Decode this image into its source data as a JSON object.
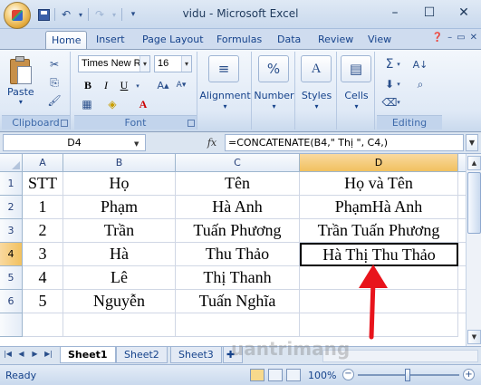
{
  "window": {
    "title": "vidu - Microsoft Excel",
    "minimize": "–",
    "maximize": "☐",
    "close": "✕"
  },
  "quick_access": {
    "undo": "↶",
    "redo": "↷",
    "more": "▾"
  },
  "tabs": [
    "Home",
    "Insert",
    "Page Layout",
    "Formulas",
    "Data",
    "Review",
    "View"
  ],
  "active_tab": "Home",
  "ribbon": {
    "clipboard": {
      "label": "Clipboard",
      "paste": "Paste"
    },
    "font": {
      "label": "Font",
      "font_name": "Times New Ro",
      "font_size": "16",
      "bold": "B",
      "italic": "I",
      "underline": "U"
    },
    "alignment": {
      "label": "Alignment"
    },
    "number": {
      "label": "Number",
      "icon": "%"
    },
    "styles": {
      "label": "Styles"
    },
    "cells": {
      "label": "Cells"
    },
    "editing": {
      "label": "Editing",
      "sum": "Σ"
    }
  },
  "formula_bar": {
    "name_box": "D4",
    "fx": "fx",
    "formula": "=CONCATENATE(B4,\" Thị \", C4,)"
  },
  "columns": [
    "A",
    "B",
    "C",
    "D"
  ],
  "selected_column": "D",
  "rows": [
    {
      "num": "1",
      "cells": [
        "STT",
        "Họ",
        "Tên",
        "Họ và Tên"
      ]
    },
    {
      "num": "2",
      "cells": [
        "1",
        "Phạm",
        "Hà Anh",
        "PhạmHà Anh"
      ]
    },
    {
      "num": "3",
      "cells": [
        "2",
        "Trần",
        "Tuấn Phương",
        "Trần Tuấn Phương"
      ]
    },
    {
      "num": "4",
      "cells": [
        "3",
        "Hà",
        "Thu Thảo",
        "Hà Thị Thu Thảo"
      ]
    },
    {
      "num": "5",
      "cells": [
        "4",
        "Lê",
        "Thị Thanh",
        ""
      ]
    },
    {
      "num": "6",
      "cells": [
        "5",
        "Nguyễn",
        "Tuấn Nghĩa",
        ""
      ]
    }
  ],
  "selected_row": "4",
  "sheets": [
    "Sheet1",
    "Sheet2",
    "Sheet3"
  ],
  "active_sheet": "Sheet1",
  "status": {
    "ready": "Ready",
    "zoom": "100%"
  },
  "watermark": "uantrimang",
  "colors": {
    "annotation_arrow": "#e8141c",
    "selection_header": "#f1c15f"
  }
}
